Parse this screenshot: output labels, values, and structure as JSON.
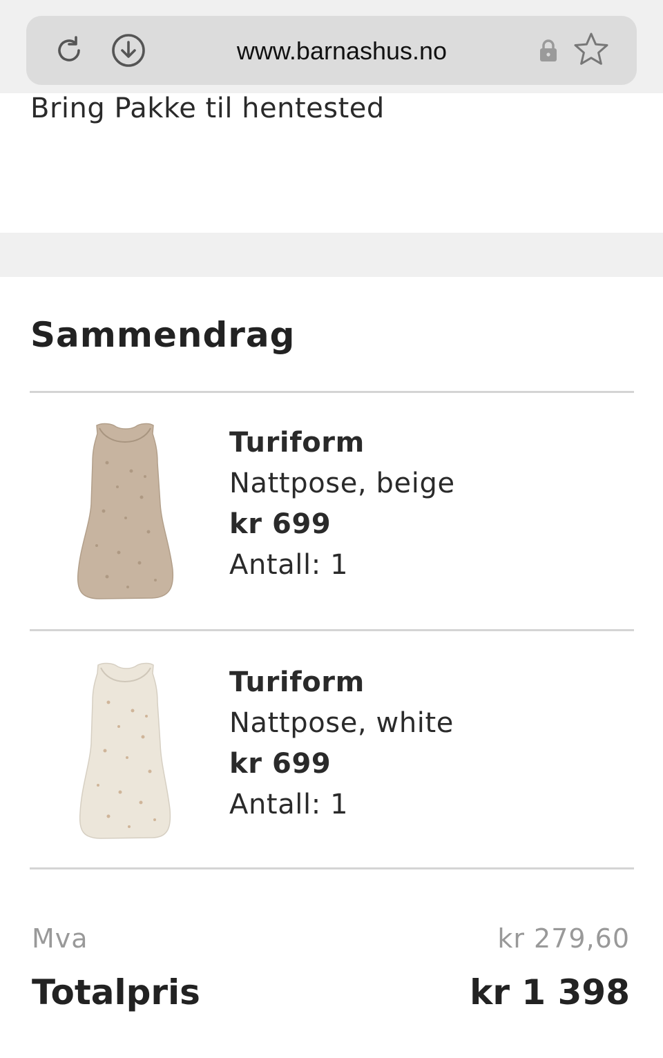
{
  "browser": {
    "url": "www.barnashus.no",
    "icons": [
      "reload-icon",
      "download-icon",
      "lock-icon",
      "star-icon"
    ]
  },
  "shipping": {
    "method": "Bring Pakke til hentested"
  },
  "summary": {
    "title": "Sammendrag",
    "items": [
      {
        "brand": "Turiform",
        "name": "Nattpose, beige",
        "price": "kr 699",
        "quantity": "Antall: 1",
        "swatch_color": "#c7b4a0"
      },
      {
        "brand": "Turiform",
        "name": "Nattpose, white",
        "price": "kr 699",
        "quantity": "Antall: 1",
        "swatch_color": "#ece6da"
      }
    ],
    "mva_label": "Mva",
    "mva_value": "kr 279,60",
    "total_label": "Totalpris",
    "total_value": "kr 1 398"
  }
}
